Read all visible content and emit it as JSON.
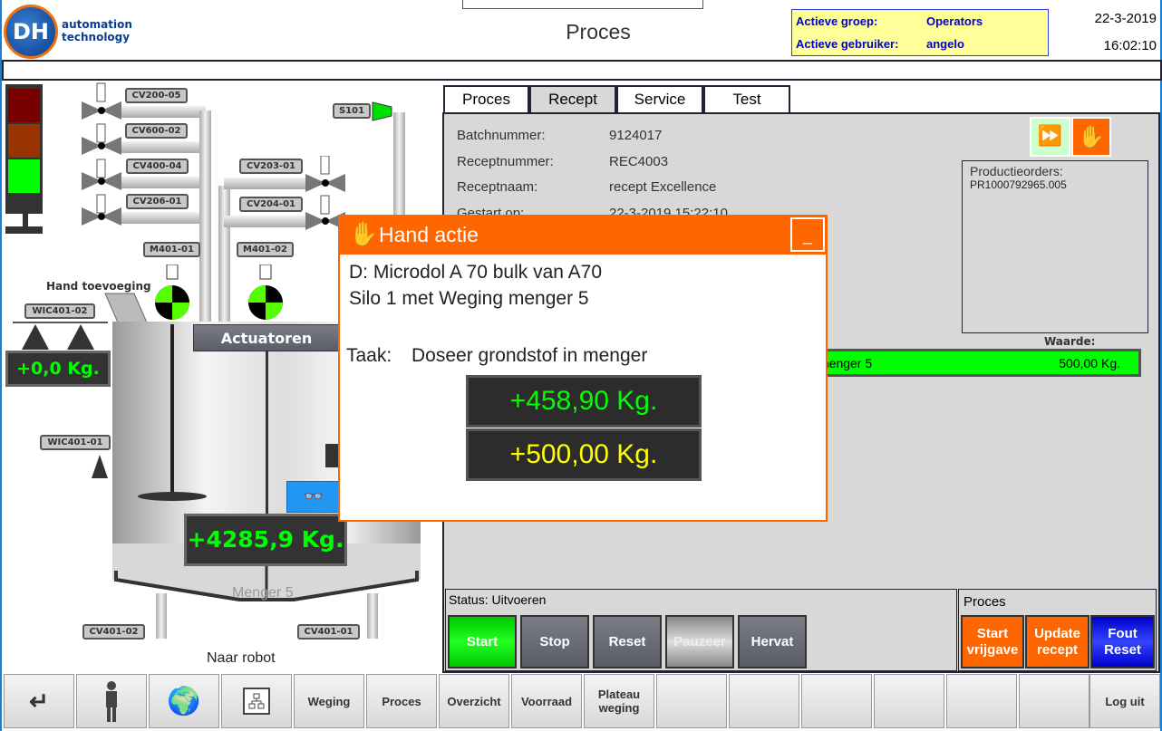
{
  "header": {
    "logo_letters": "DH",
    "logo_text_1": "automation",
    "logo_text_2": "technology",
    "title": "Proces",
    "group_label": "Actieve groep:",
    "group_value": "Operators",
    "user_label": "Actieve gebruiker:",
    "user_value": "angelo",
    "date": "22-3-2019",
    "time": "16:02:10"
  },
  "process": {
    "valves": [
      "CV200-05",
      "CV600-02",
      "CV400-04",
      "CV206-01",
      "CV203-01",
      "CV204-01"
    ],
    "silo": "S101",
    "motors": [
      "M401-01",
      "M401-02"
    ],
    "hand_label": "Hand toevoeging",
    "wic2": "WIC401-02",
    "wic1": "WIC401-01",
    "hand_weight": "+0,0 Kg.",
    "actuators": "Actuatoren",
    "mixer_weight": "+4285,9 Kg.",
    "mixer_name": "Menger 5",
    "out_valves": [
      "CV401-02",
      "CV401-01"
    ],
    "out_label": "Naar robot",
    "stacklight": {
      "red": "#7a0000",
      "orange": "#993300",
      "green": "#00ff00",
      "active": "green"
    }
  },
  "tabs": [
    {
      "label": "Proces"
    },
    {
      "label": "Recept",
      "active": true
    },
    {
      "label": "Service"
    },
    {
      "label": "Test"
    }
  ],
  "recipe": {
    "batch_label": "Batchnummer:",
    "batch": "9124017",
    "recipe_no_label": "Receptnummer:",
    "recipe_no": "REC4003",
    "recipe_name_label": "Receptnaam:",
    "recipe_name": "recept Excellence",
    "started_label": "Gestart op:",
    "started": "22-3-2019 15:22:10",
    "orders_label": "Productieorders:",
    "order": "PR1000792965.005",
    "value_label": "Waarde:",
    "step_text": "menger 5",
    "step_value": "500,00 Kg."
  },
  "status": {
    "label": "Status: Uitvoeren",
    "buttons": [
      "Start",
      "Stop",
      "Reset",
      "Pauzeer",
      "Hervat"
    ]
  },
  "proc_panel": {
    "label": "Proces",
    "buttons": [
      "Start vrijgave",
      "Update recept",
      "Fout Reset"
    ]
  },
  "dialog": {
    "title": "Hand actie",
    "minimize": "_",
    "line1": "D: Microdol A 70 bulk van A70",
    "line2": "Silo 1 met Weging menger 5",
    "task_label": "Taak:",
    "task": "Doseer grondstof in menger",
    "actual": "+458,90 Kg.",
    "setpoint": "+500,00 Kg."
  },
  "nav": {
    "icons": [
      "enter-icon",
      "user-icon",
      "globe-flag-icon",
      "network-icon"
    ],
    "items": [
      "Weging",
      "Proces",
      "Overzicht",
      "Voorraad",
      "Plateau weging",
      "",
      "",
      "",
      "",
      "",
      "",
      "Log uit"
    ]
  },
  "colors": {
    "accent": "#ff6600",
    "green": "#00ff00",
    "blue": "#0000ff",
    "info_bg": "#ffff99"
  }
}
